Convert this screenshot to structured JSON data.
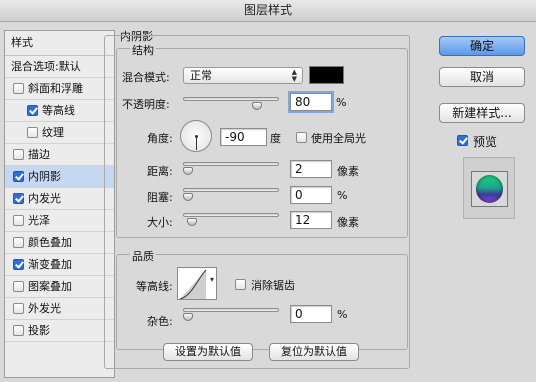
{
  "window": {
    "title": "图层样式"
  },
  "styles_panel": {
    "header": "样式",
    "blend_options": "混合选项:默认",
    "items": [
      {
        "label": "斜面和浮雕",
        "checked": false,
        "sub": false,
        "selected": false
      },
      {
        "label": "等高线",
        "checked": true,
        "sub": true,
        "selected": false
      },
      {
        "label": "纹理",
        "checked": false,
        "sub": true,
        "selected": false
      },
      {
        "label": "描边",
        "checked": false,
        "sub": false,
        "selected": false
      },
      {
        "label": "内阴影",
        "checked": true,
        "sub": false,
        "selected": true
      },
      {
        "label": "内发光",
        "checked": true,
        "sub": false,
        "selected": false
      },
      {
        "label": "光泽",
        "checked": false,
        "sub": false,
        "selected": false
      },
      {
        "label": "颜色叠加",
        "checked": false,
        "sub": false,
        "selected": false
      },
      {
        "label": "渐变叠加",
        "checked": true,
        "sub": false,
        "selected": false
      },
      {
        "label": "图案叠加",
        "checked": false,
        "sub": false,
        "selected": false
      },
      {
        "label": "外发光",
        "checked": false,
        "sub": false,
        "selected": false
      },
      {
        "label": "投影",
        "checked": false,
        "sub": false,
        "selected": false
      }
    ]
  },
  "inner_shadow": {
    "title": "内阴影",
    "structure": {
      "title": "结构",
      "blend_mode_label": "混合模式:",
      "blend_mode_value": "正常",
      "blend_color": "#000000",
      "opacity_label": "不透明度:",
      "opacity_value": "80",
      "opacity_unit": "%",
      "opacity_level": 0.8,
      "angle_label": "角度:",
      "angle_value": "-90",
      "angle_unit": "度",
      "global_light_label": "使用全局光",
      "global_light_checked": false,
      "distance_label": "距离:",
      "distance_value": "2",
      "distance_unit": "像素",
      "distance_level": 0.0,
      "choke_label": "阻塞:",
      "choke_value": "0",
      "choke_unit": "%",
      "choke_level": 0.0,
      "size_label": "大小:",
      "size_value": "12",
      "size_unit": "像素",
      "size_level": 0.05
    },
    "quality": {
      "title": "品质",
      "contour_label": "等高线:",
      "antialias_label": "消除锯齿",
      "antialias_checked": false,
      "noise_label": "杂色:",
      "noise_value": "0",
      "noise_unit": "%",
      "noise_level": 0.0
    },
    "set_default_label": "设置为默认值",
    "reset_default_label": "复位为默认值"
  },
  "actions": {
    "ok_label": "确定",
    "cancel_label": "取消",
    "new_style_label": "新建样式...",
    "preview_label": "预览",
    "preview_checked": true
  },
  "colors": {
    "accent": "#5b98ec",
    "selection": "#c6d7f1"
  }
}
